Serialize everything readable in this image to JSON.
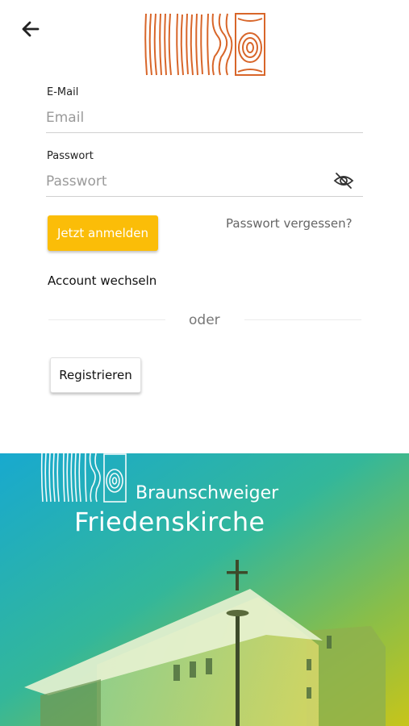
{
  "header": {
    "back_icon": "arrow-left-icon",
    "logo": "wood-rings-logo"
  },
  "form": {
    "email_label": "E-Mail",
    "email_placeholder": "Email",
    "email_value": "",
    "password_label": "Passwort",
    "password_placeholder": "Passwort",
    "password_value": "",
    "visibility_icon": "eye-off-icon"
  },
  "actions": {
    "login_label": "Jetzt anmelden",
    "forgot_label": "Passwort vergessen?",
    "switch_account_label": "Account wechseln",
    "divider_label": "oder",
    "register_label": "Registrieren"
  },
  "banner": {
    "subtitle": "Braunschweiger",
    "title": "Friedenskirche"
  },
  "colors": {
    "accent": "#fbbd08",
    "logo_orange": "#d8662a",
    "banner_teal": "#1aaec8",
    "banner_yellow": "#c9c41c"
  }
}
